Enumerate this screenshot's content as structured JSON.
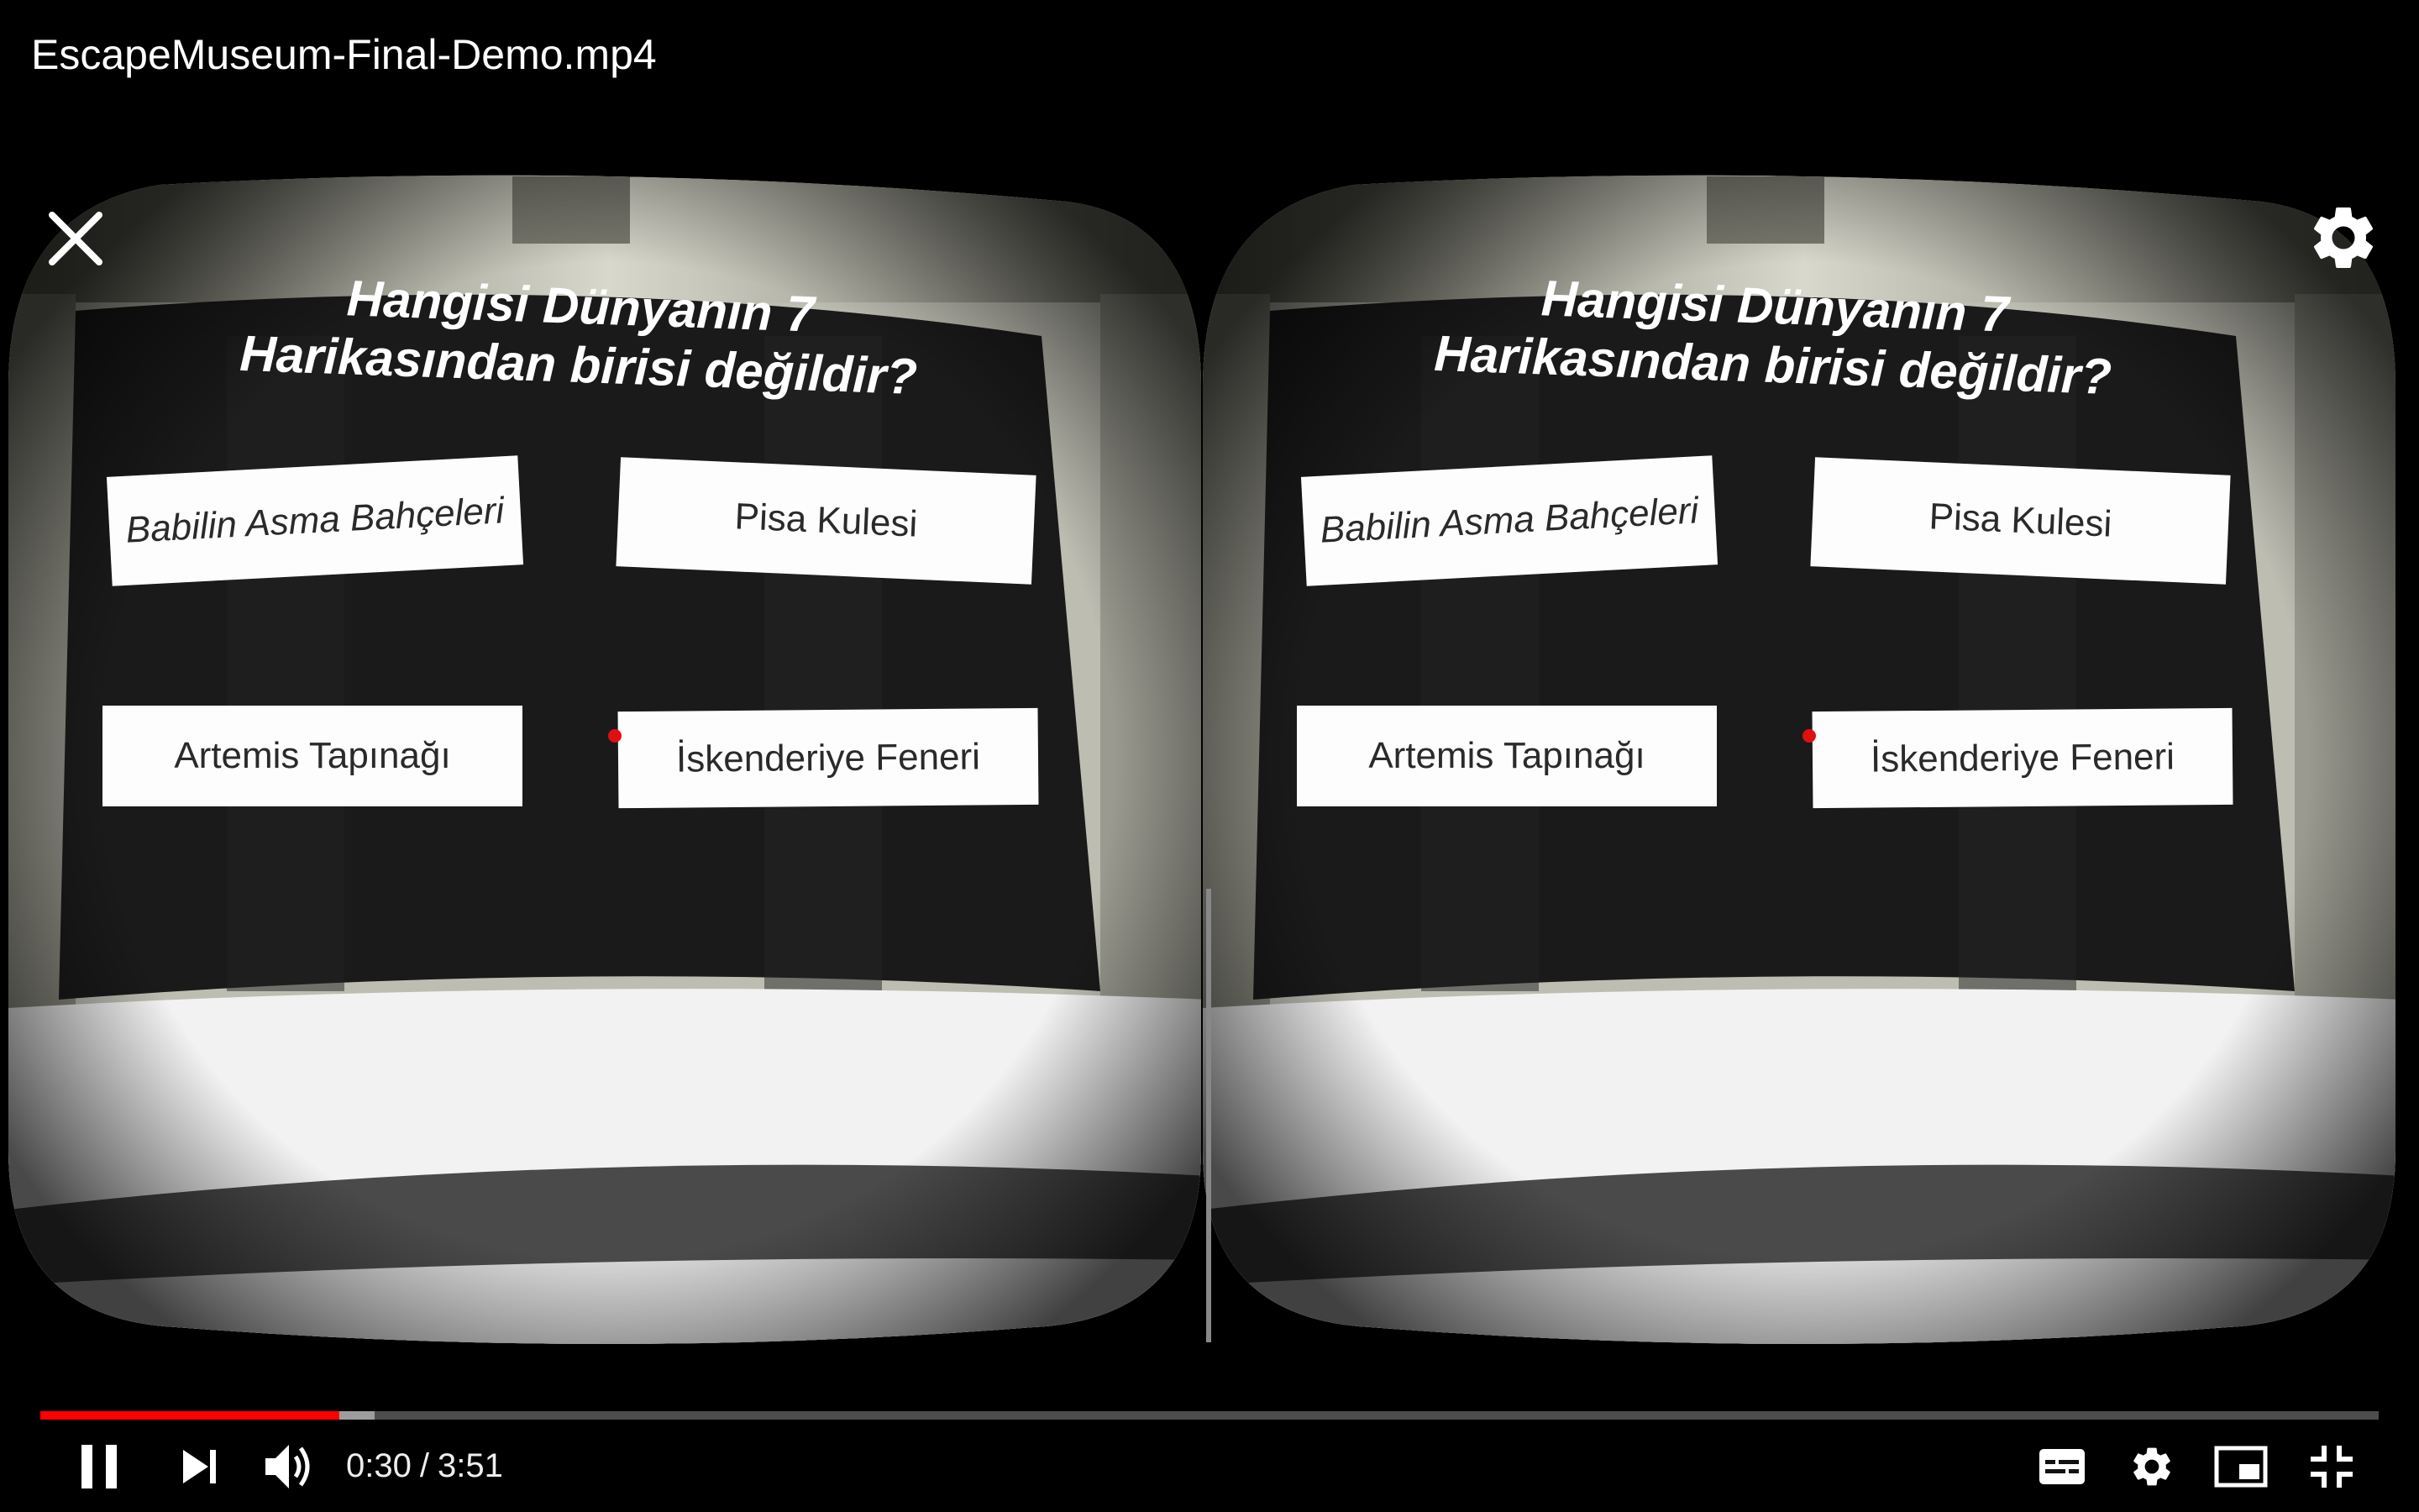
{
  "video": {
    "title": "EscapeMuseum-Final-Demo.mp4"
  },
  "vr_overlay": {
    "close_icon": "close-icon",
    "settings_icon": "gear-icon"
  },
  "quiz": {
    "question_line1": "Hangisi Dünyanın 7",
    "question_line2": "Harikasından birisi değildir?",
    "answers": [
      "Babilin Asma Bahçeleri",
      "Pisa Kulesi",
      "Artemis Tapınağı",
      "İskenderiye Feneri"
    ],
    "gaze_pointer_color": "#e01010"
  },
  "controls": {
    "current_time": "0:30",
    "separator": "/",
    "duration": "3:51",
    "played_fraction": 0.128,
    "buffered_fraction": 0.143,
    "progress_color": "#ff0000",
    "icons": {
      "pause": "pause-icon",
      "next": "next-icon",
      "volume": "volume-icon",
      "captions": "captions-icon",
      "settings": "gear-icon",
      "miniplayer": "miniplayer-icon",
      "fullscreen_exit": "fullscreen-exit-icon"
    }
  }
}
